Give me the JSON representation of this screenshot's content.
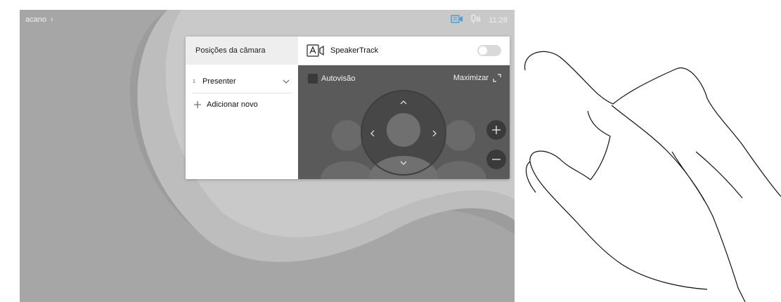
{
  "header": {
    "title": "acano",
    "title_chevron": "chevron-right-icon",
    "time": "11:28"
  },
  "icons": {
    "camera_status": "camera-share-icon",
    "mic_status": "microphone-icon"
  },
  "camera_panel": {
    "presets_title": "Posições da câmara",
    "presets": [
      {
        "number": "1",
        "label": "Presenter"
      }
    ],
    "add_new_label": "Adicionar novo",
    "speakertrack_label": "SpeakerTrack",
    "speakertrack_on": false,
    "selfview_label": "Autovisão",
    "maximize_label": "Maximizar"
  },
  "colors": {
    "background": "#9e9e9e",
    "panel_dark": "#5a5a5a",
    "accent_icon": "#4a9fd8"
  }
}
